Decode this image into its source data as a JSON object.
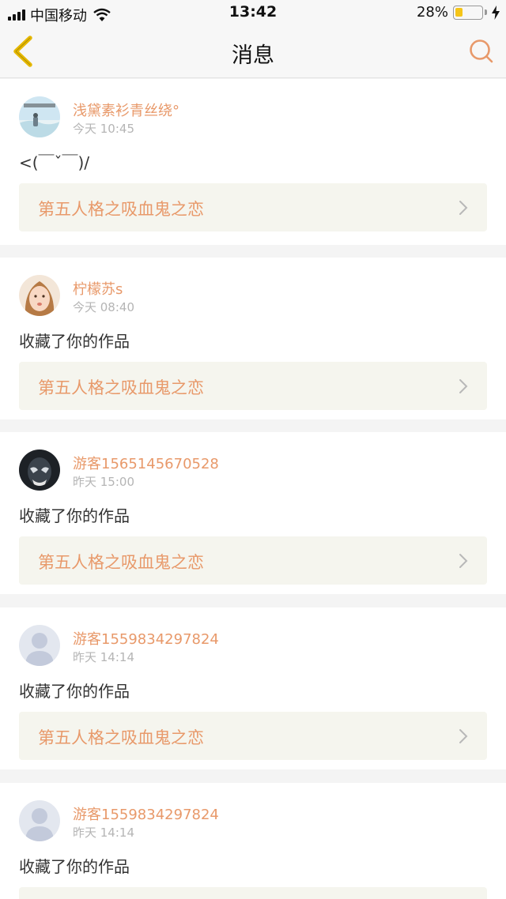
{
  "status_bar": {
    "carrier": "中国移动",
    "time": "13:42",
    "battery": "28%",
    "battery_level": 0.28,
    "icons": [
      "signal-icon",
      "wifi-icon",
      "battery-icon",
      "charging-bolt-icon"
    ]
  },
  "nav": {
    "title": "消息",
    "back_icon": "chevron-left-icon",
    "search_icon": "search-icon"
  },
  "colors": {
    "accent": "#e8996a",
    "back_arrow": "#e6b800",
    "link_bg": "#f5f5ee",
    "timestamp": "#b5b5b5"
  },
  "messages": [
    {
      "username": "浅黛素衫青丝绕°",
      "time": "今天 10:45",
      "text": "<(￣ˇ￣)/",
      "work": "第五人格之吸血鬼之恋"
    },
    {
      "username": "柠檬苏s",
      "time": "今天 08:40",
      "text": "收藏了你的作品",
      "work": "第五人格之吸血鬼之恋"
    },
    {
      "username": "游客1565145670528",
      "time": "昨天 15:00",
      "text": "收藏了你的作品",
      "work": "第五人格之吸血鬼之恋"
    },
    {
      "username": "游客1559834297824",
      "time": "昨天 14:14",
      "text": "收藏了你的作品",
      "work": "第五人格之吸血鬼之恋"
    },
    {
      "username": "游客1559834297824",
      "time": "昨天 14:14",
      "text": "收藏了你的作品",
      "work": ""
    }
  ]
}
